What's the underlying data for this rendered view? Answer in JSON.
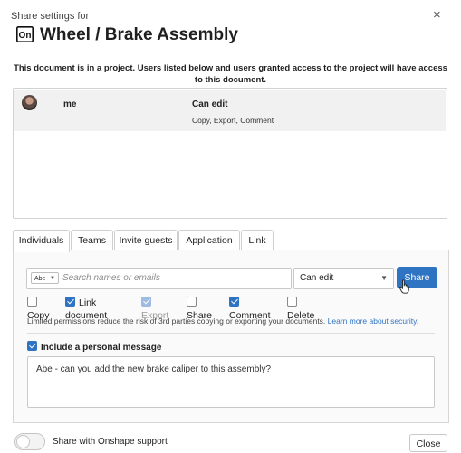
{
  "dialog": {
    "subtitle": "Share settings for",
    "title": "Wheel / Brake Assembly",
    "close_glyph": "×",
    "notice": "This document is in a project. Users listed below and users granted access to the project will have access to this document."
  },
  "permissions": [
    {
      "user": "me",
      "level": "Can edit",
      "detail": "Copy, Export, Comment"
    }
  ],
  "tabs": [
    {
      "label": "Individuals",
      "active": true
    },
    {
      "label": "Teams",
      "active": false
    },
    {
      "label": "Invite guests",
      "active": false
    },
    {
      "label": "Application",
      "active": false
    },
    {
      "label": "Link",
      "active": false
    }
  ],
  "share_form": {
    "chip": "Abe",
    "search_placeholder": "Search names or emails",
    "permission_select": "Can edit",
    "share_button": "Share",
    "options": [
      {
        "label": "Copy",
        "checked": false,
        "disabled": false
      },
      {
        "label": "Link document",
        "checked": true,
        "disabled": false
      },
      {
        "label": "Export",
        "checked": true,
        "disabled": true
      },
      {
        "label": "Share",
        "checked": false,
        "disabled": false
      },
      {
        "label": "Comment",
        "checked": true,
        "disabled": false
      },
      {
        "label": "Delete",
        "checked": false,
        "disabled": false
      }
    ],
    "limited_note": "Limited permissions reduce the risk of 3rd parties copying or exporting your documents.",
    "learn_more_link": "Learn more about security.",
    "personal_message_label": "Include a personal message",
    "personal_message_checked": true,
    "personal_message": "Abe - can you add the new brake caliper to this assembly?"
  },
  "footer": {
    "support_toggle_label": "Share with Onshape support",
    "support_toggle_on": false,
    "close_button": "Close"
  },
  "icons": {
    "logo": "onshape-logo-icon",
    "close": "close-icon",
    "chip_caret": "chevron-down-icon",
    "select_caret": "caret-down-icon",
    "cursor": "hand-pointer-icon"
  },
  "colors": {
    "accent": "#2f73c3",
    "permission_row_bg": "#f1f1f1",
    "panel_bg": "#fafafa"
  }
}
